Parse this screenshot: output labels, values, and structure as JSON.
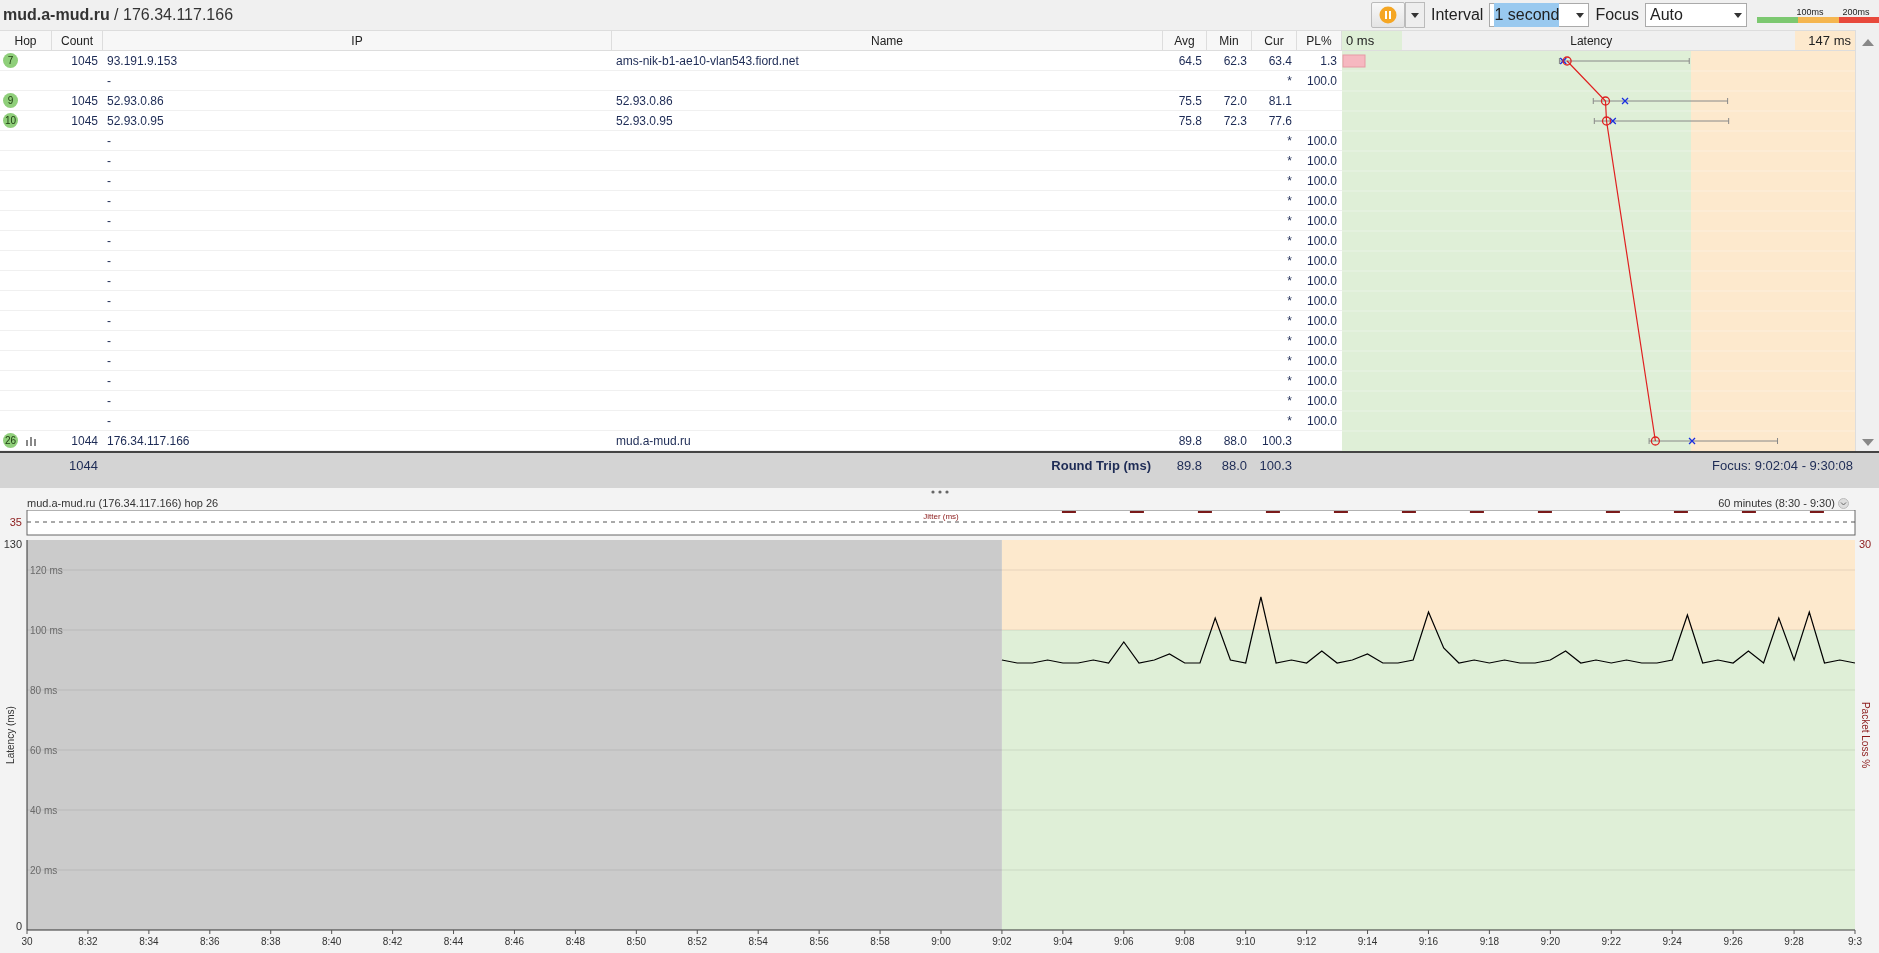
{
  "title": "**mud.a-mud.ru** / 176.34.117.166",
  "toolbar": {
    "interval_label": "Interval",
    "interval_value": "1 second",
    "focus_label": "Focus",
    "focus_value": "Auto",
    "scale_labels": [
      "100ms",
      "200ms"
    ]
  },
  "table": {
    "columns": [
      "Hop",
      "Count",
      "IP",
      "Name",
      "Avg",
      "Min",
      "Cur",
      "PL%"
    ],
    "latency_header": {
      "min": "0 ms",
      "title": "Latency",
      "max": "147 ms"
    },
    "rows": [
      {
        "hop": "7",
        "count": "1045",
        "ip": "93.191.9.153",
        "name": "ams-nik-b1-ae10-vlan543.fiord.net",
        "avg": "64.5",
        "min": "62.3",
        "cur": "63.4",
        "pl": "1.3",
        "loss_marker": true,
        "graph_icon": false
      },
      {
        "ip": "-",
        "cur": "*",
        "pl": "100.0",
        "loss_marker": false,
        "graph_icon": false
      },
      {
        "hop": "9",
        "count": "1045",
        "ip": "52.93.0.86",
        "name": "52.93.0.86",
        "avg": "75.5",
        "min": "72.0",
        "cur": "81.1",
        "loss_marker": false,
        "graph_icon": false
      },
      {
        "hop": "10",
        "count": "1045",
        "ip": "52.93.0.95",
        "name": "52.93.0.95",
        "avg": "75.8",
        "min": "72.3",
        "cur": "77.6",
        "loss_marker": false,
        "graph_icon": false
      },
      {
        "ip": "-",
        "cur": "*",
        "pl": "100.0",
        "loss_marker": false,
        "graph_icon": false
      },
      {
        "ip": "-",
        "cur": "*",
        "pl": "100.0",
        "loss_marker": false,
        "graph_icon": false
      },
      {
        "ip": "-",
        "cur": "*",
        "pl": "100.0",
        "loss_marker": false,
        "graph_icon": false
      },
      {
        "ip": "-",
        "cur": "*",
        "pl": "100.0",
        "loss_marker": false,
        "graph_icon": false
      },
      {
        "ip": "-",
        "cur": "*",
        "pl": "100.0",
        "loss_marker": false,
        "graph_icon": false
      },
      {
        "ip": "-",
        "cur": "*",
        "pl": "100.0",
        "loss_marker": false,
        "graph_icon": false
      },
      {
        "ip": "-",
        "cur": "*",
        "pl": "100.0",
        "loss_marker": false,
        "graph_icon": false
      },
      {
        "ip": "-",
        "cur": "*",
        "pl": "100.0",
        "loss_marker": false,
        "graph_icon": false
      },
      {
        "ip": "-",
        "cur": "*",
        "pl": "100.0",
        "loss_marker": false,
        "graph_icon": false
      },
      {
        "ip": "-",
        "cur": "*",
        "pl": "100.0",
        "loss_marker": false,
        "graph_icon": false
      },
      {
        "ip": "-",
        "cur": "*",
        "pl": "100.0",
        "loss_marker": false,
        "graph_icon": false
      },
      {
        "ip": "-",
        "cur": "*",
        "pl": "100.0",
        "loss_marker": false,
        "graph_icon": false
      },
      {
        "ip": "-",
        "cur": "*",
        "pl": "100.0",
        "loss_marker": false,
        "graph_icon": false
      },
      {
        "ip": "-",
        "cur": "*",
        "pl": "100.0",
        "loss_marker": false,
        "graph_icon": false
      },
      {
        "ip": "-",
        "cur": "*",
        "pl": "100.0",
        "loss_marker": false,
        "graph_icon": false
      },
      {
        "hop": "26",
        "count": "1044",
        "ip": "176.34.117.166",
        "name": "mud.a-mud.ru",
        "avg": "89.8",
        "min": "88.0",
        "cur": "100.3",
        "loss_marker": false,
        "graph_icon": true
      }
    ],
    "summary": {
      "count": "1044",
      "label": "Round Trip (ms)",
      "avg": "89.8",
      "min": "88.0",
      "cur": "100.3",
      "focus": "Focus: 9:02:04 - 9:30:08"
    }
  },
  "timeline": {
    "header": "mud.a-mud.ru (176.34.117.166) hop 26",
    "range": "60 minutes (8:30 - 9:30)",
    "jitter": {
      "label": "Jitter (ms)",
      "value_label": "35"
    },
    "loss_axis": {
      "label": "Packet Loss %",
      "max_label": "30"
    },
    "y_range_labels": [
      "130",
      "0"
    ],
    "chart_data": {
      "type": "line",
      "ylabel": "Latency (ms)",
      "ylim": [
        0,
        130
      ],
      "grid": true,
      "bands": [
        {
          "axis": "y",
          "from": 100,
          "to": 130,
          "color": "#fde9cd"
        },
        {
          "axis": "y",
          "from": 0,
          "to": 100,
          "color": "#dfefd7"
        }
      ],
      "categories": [
        "30",
        null,
        null,
        null,
        "8:32",
        null,
        null,
        null,
        "8:34",
        null,
        null,
        null,
        "8:36",
        null,
        null,
        null,
        "8:38",
        null,
        null,
        null,
        "8:40",
        null,
        null,
        null,
        "8:42",
        null,
        null,
        null,
        "8:44",
        null,
        null,
        null,
        "8:46",
        null,
        null,
        null,
        "8:48",
        null,
        null,
        null,
        "8:50",
        null,
        null,
        null,
        "8:52",
        null,
        null,
        null,
        "8:54",
        null,
        null,
        null,
        "8:56",
        null,
        null,
        null,
        "8:58",
        null,
        null,
        null,
        "9:00",
        null,
        null,
        null,
        "9:02",
        null,
        null,
        null,
        "9:04",
        null,
        null,
        null,
        "9:06",
        null,
        null,
        null,
        "9:08",
        null,
        null,
        null,
        "9:10",
        null,
        null,
        null,
        "9:12",
        null,
        null,
        null,
        "9:14",
        null,
        null,
        null,
        "9:16",
        null,
        null,
        null,
        "9:18",
        null,
        null,
        null,
        "9:20",
        null,
        null,
        null,
        "9:22",
        null,
        null,
        null,
        "9:24",
        null,
        null,
        null,
        "9:26",
        null,
        null,
        null,
        "9:28",
        null,
        null,
        null,
        "9:3"
      ],
      "yticks": [
        {
          "value": 20,
          "label": "20 ms"
        },
        {
          "value": 40,
          "label": "40 ms"
        },
        {
          "value": 60,
          "label": "60 ms"
        },
        {
          "value": 80,
          "label": "80 ms"
        },
        {
          "value": 100,
          "label": "100 ms"
        },
        {
          "value": 120,
          "label": "120 ms"
        }
      ],
      "series": [
        {
          "color": "#000000",
          "values": [
            null,
            null,
            null,
            null,
            null,
            null,
            null,
            null,
            null,
            null,
            null,
            null,
            null,
            null,
            null,
            null,
            null,
            null,
            null,
            null,
            null,
            null,
            null,
            null,
            null,
            null,
            null,
            null,
            null,
            null,
            null,
            null,
            null,
            null,
            null,
            null,
            null,
            null,
            null,
            null,
            null,
            null,
            null,
            null,
            null,
            null,
            null,
            null,
            null,
            null,
            null,
            null,
            null,
            null,
            null,
            null,
            null,
            null,
            null,
            null,
            null,
            null,
            null,
            null,
            90,
            89,
            89,
            90,
            89,
            89,
            90,
            89,
            96,
            89,
            90,
            92,
            89,
            89,
            104,
            90,
            89,
            111,
            89,
            90,
            89,
            93,
            89,
            90,
            92,
            89,
            89,
            90,
            106,
            94,
            89,
            90,
            89,
            90,
            89,
            89,
            90,
            93,
            89,
            90,
            89,
            90,
            89,
            89,
            90,
            105,
            89,
            90,
            89,
            93,
            89,
            104,
            90,
            106,
            89,
            90,
            89
          ]
        }
      ]
    }
  }
}
